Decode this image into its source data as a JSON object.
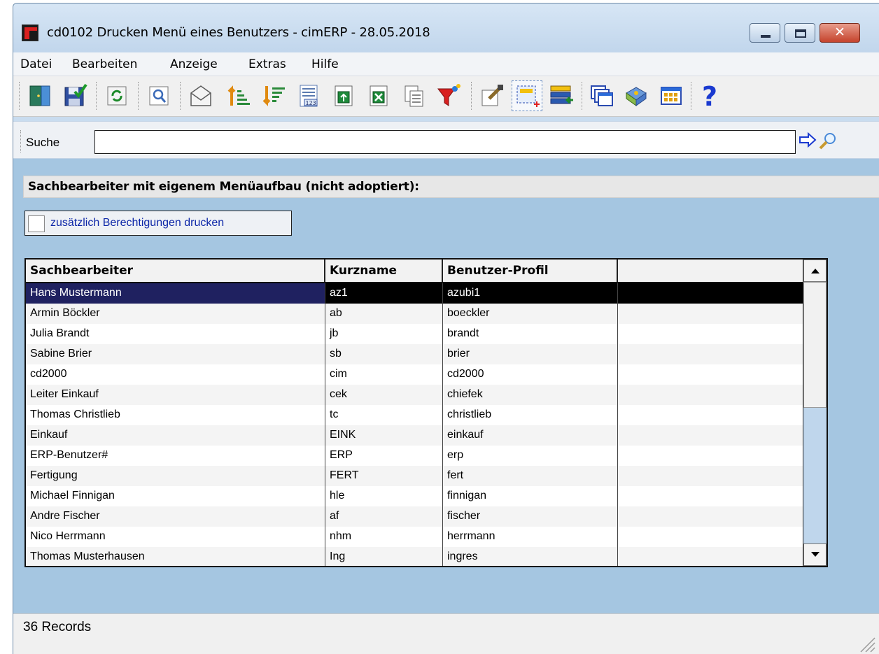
{
  "window": {
    "title": "cd0102 Drucken Menü eines Benutzers - cimERP - 28.05.2018"
  },
  "menu": [
    "Datei",
    "Bearbeiten",
    "Anzeige",
    "Extras",
    "Hilfe"
  ],
  "toolbar": {
    "buttons": [
      "exit-door-icon",
      "save-icon",
      "refresh-icon",
      "print-preview-icon",
      "email-icon",
      "sort-ascending-icon",
      "sort-descending-icon",
      "number-list-icon",
      "export-icon",
      "excel-export-icon",
      "copy-icon",
      "filter-icon",
      "edit-properties-icon",
      "select-range-icon",
      "add-rows-icon",
      "windows-icon",
      "book-icon",
      "columns-icon",
      "help-icon"
    ]
  },
  "search": {
    "label": "Suche",
    "value": ""
  },
  "section": {
    "title": "Sachbearbeiter mit eigenem Menüaufbau (nicht adoptiert):"
  },
  "option": {
    "label": "zusätzlich Berechtigungen drucken",
    "checked": false
  },
  "table": {
    "columns": [
      "Sachbearbeiter",
      "Kurzname",
      "Benutzer-Profil",
      ""
    ],
    "rows": [
      [
        "Hans Mustermann",
        "az1",
        "azubi1"
      ],
      [
        "Armin Böckler",
        "ab",
        "boeckler"
      ],
      [
        "Julia Brandt",
        "jb",
        "brandt"
      ],
      [
        "Sabine Brier",
        "sb",
        "brier"
      ],
      [
        "cd2000",
        "cim",
        "cd2000"
      ],
      [
        "Leiter Einkauf",
        "cek",
        "chiefek"
      ],
      [
        "Thomas Christlieb",
        "tc",
        "christlieb"
      ],
      [
        "Einkauf",
        "EINK",
        "einkauf"
      ],
      [
        "ERP-Benutzer#",
        "ERP",
        "erp"
      ],
      [
        "Fertigung",
        "FERT",
        "fert"
      ],
      [
        "Michael Finnigan",
        "hle",
        "finnigan"
      ],
      [
        "Andre Fischer",
        "af",
        "fischer"
      ],
      [
        "Nico Herrmann",
        "nhm",
        "herrmann"
      ],
      [
        "Thomas Musterhausen",
        "Ing",
        "ingres"
      ]
    ],
    "selected_index": 0
  },
  "status": {
    "text": "36 Records"
  },
  "colors": {
    "window_bg": "#c9dcef",
    "content_bg": "#a5c6e1",
    "selected_row": "#000000",
    "link_text": "#0d27a8"
  }
}
